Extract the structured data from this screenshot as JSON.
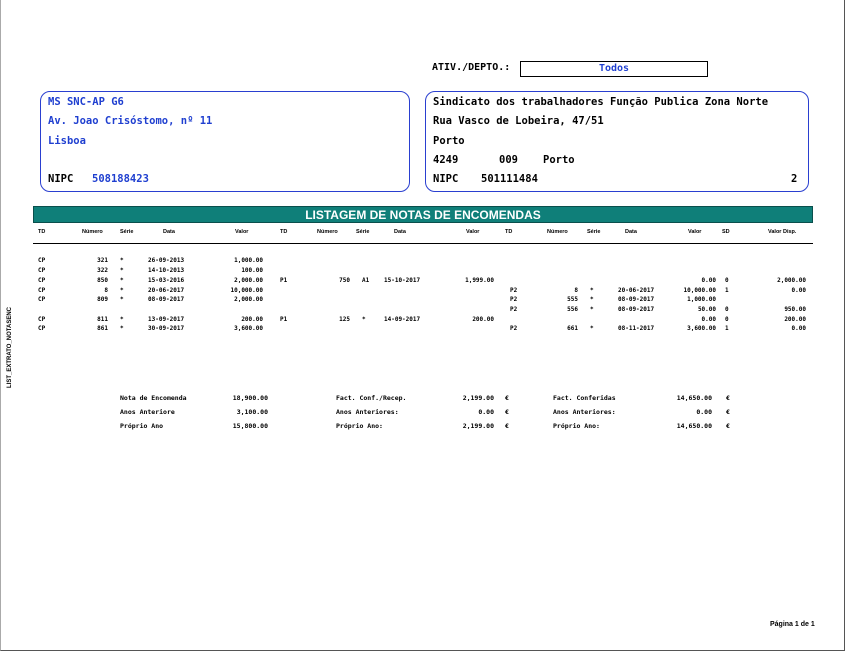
{
  "side_label": "LIST_EXTRATO_NOTASENC",
  "ativ": {
    "label": "ATIV./DEPTO.:",
    "value": "Todos"
  },
  "company": {
    "name": "MS SNC-AP G6",
    "address": "Av. Joao Crisóstomo, nº 11",
    "city": "Lisboa",
    "nipc_label": "NIPC",
    "nipc": "508188423"
  },
  "client": {
    "name": "Sindicato dos trabalhadores Função Publica Zona Norte",
    "address": "Rua Vasco de Lobeira, 47/51",
    "city": "Porto",
    "postal1": "4249",
    "postal2": "009",
    "postal_city": "Porto",
    "nipc_label": "NIPC",
    "nipc": "501111484",
    "number": "2"
  },
  "title": "LISTAGEM DE NOTAS DE ENCOMENDAS",
  "headers": [
    "TD",
    "Número",
    "Série",
    "Data",
    "Valor",
    "TD",
    "Número",
    "Série",
    "Data",
    "Valor",
    "TD",
    "Número",
    "Série",
    "Data",
    "Valor",
    "SD",
    "Valor Disp."
  ],
  "rows": [
    [
      "CP",
      "321",
      "*",
      "26-09-2013",
      "1,000.00",
      "",
      "",
      "",
      "",
      "",
      "",
      "",
      "",
      "",
      "",
      "",
      ""
    ],
    [
      "CP",
      "322",
      "*",
      "14-10-2013",
      "100.00",
      "",
      "",
      "",
      "",
      "",
      "",
      "",
      "",
      "",
      "",
      "",
      ""
    ],
    [
      "CP",
      "850",
      "*",
      "15-03-2016",
      "2,000.00",
      "P1",
      "750",
      "A1",
      "15-10-2017",
      "1,999.00",
      "",
      "",
      "",
      "",
      "0.00",
      "0",
      "2,000.00"
    ],
    [
      "CP",
      "8",
      "*",
      "20-06-2017",
      "10,000.00",
      "",
      "",
      "",
      "",
      "",
      "P2",
      "8",
      "*",
      "20-06-2017",
      "10,000.00",
      "1",
      "0.00"
    ],
    [
      "CP",
      "809",
      "*",
      "08-09-2017",
      "2,000.00",
      "",
      "",
      "",
      "",
      "",
      "P2",
      "555",
      "*",
      "08-09-2017",
      "1,000.00",
      "",
      ""
    ],
    [
      "",
      "",
      "",
      "",
      "",
      "",
      "",
      "",
      "",
      "",
      "P2",
      "556",
      "*",
      "08-09-2017",
      "50.00",
      "0",
      "950.00"
    ],
    [
      "CP",
      "811",
      "*",
      "13-09-2017",
      "200.00",
      "P1",
      "125",
      "*",
      "14-09-2017",
      "200.00",
      "",
      "",
      "",
      "",
      "0.00",
      "0",
      "200.00"
    ],
    [
      "CP",
      "861",
      "*",
      "30-09-2017",
      "3,600.00",
      "",
      "",
      "",
      "",
      "",
      "P2",
      "661",
      "*",
      "08-11-2017",
      "3,600.00",
      "1",
      "0.00"
    ]
  ],
  "totals": {
    "col1": [
      [
        "Nota de Encomenda",
        "18,900.00"
      ],
      [
        "Anos Anteriore",
        "3,100.00"
      ],
      [
        "Próprio Ano",
        "15,800.00"
      ]
    ],
    "col2": [
      [
        "Fact. Conf./Recep.",
        "2,199.00",
        "€"
      ],
      [
        "Anos Anteriores:",
        "0.00",
        "€"
      ],
      [
        "Próprio Ano:",
        "2,199.00",
        "€"
      ]
    ],
    "col3": [
      [
        "Fact.  Conferidas",
        "14,650.00",
        "€"
      ],
      [
        "Anos Anteriores:",
        "0.00",
        "€"
      ],
      [
        "Próprio Ano:",
        "14,650.00",
        "€"
      ]
    ]
  },
  "page": "Página 1 de 1"
}
